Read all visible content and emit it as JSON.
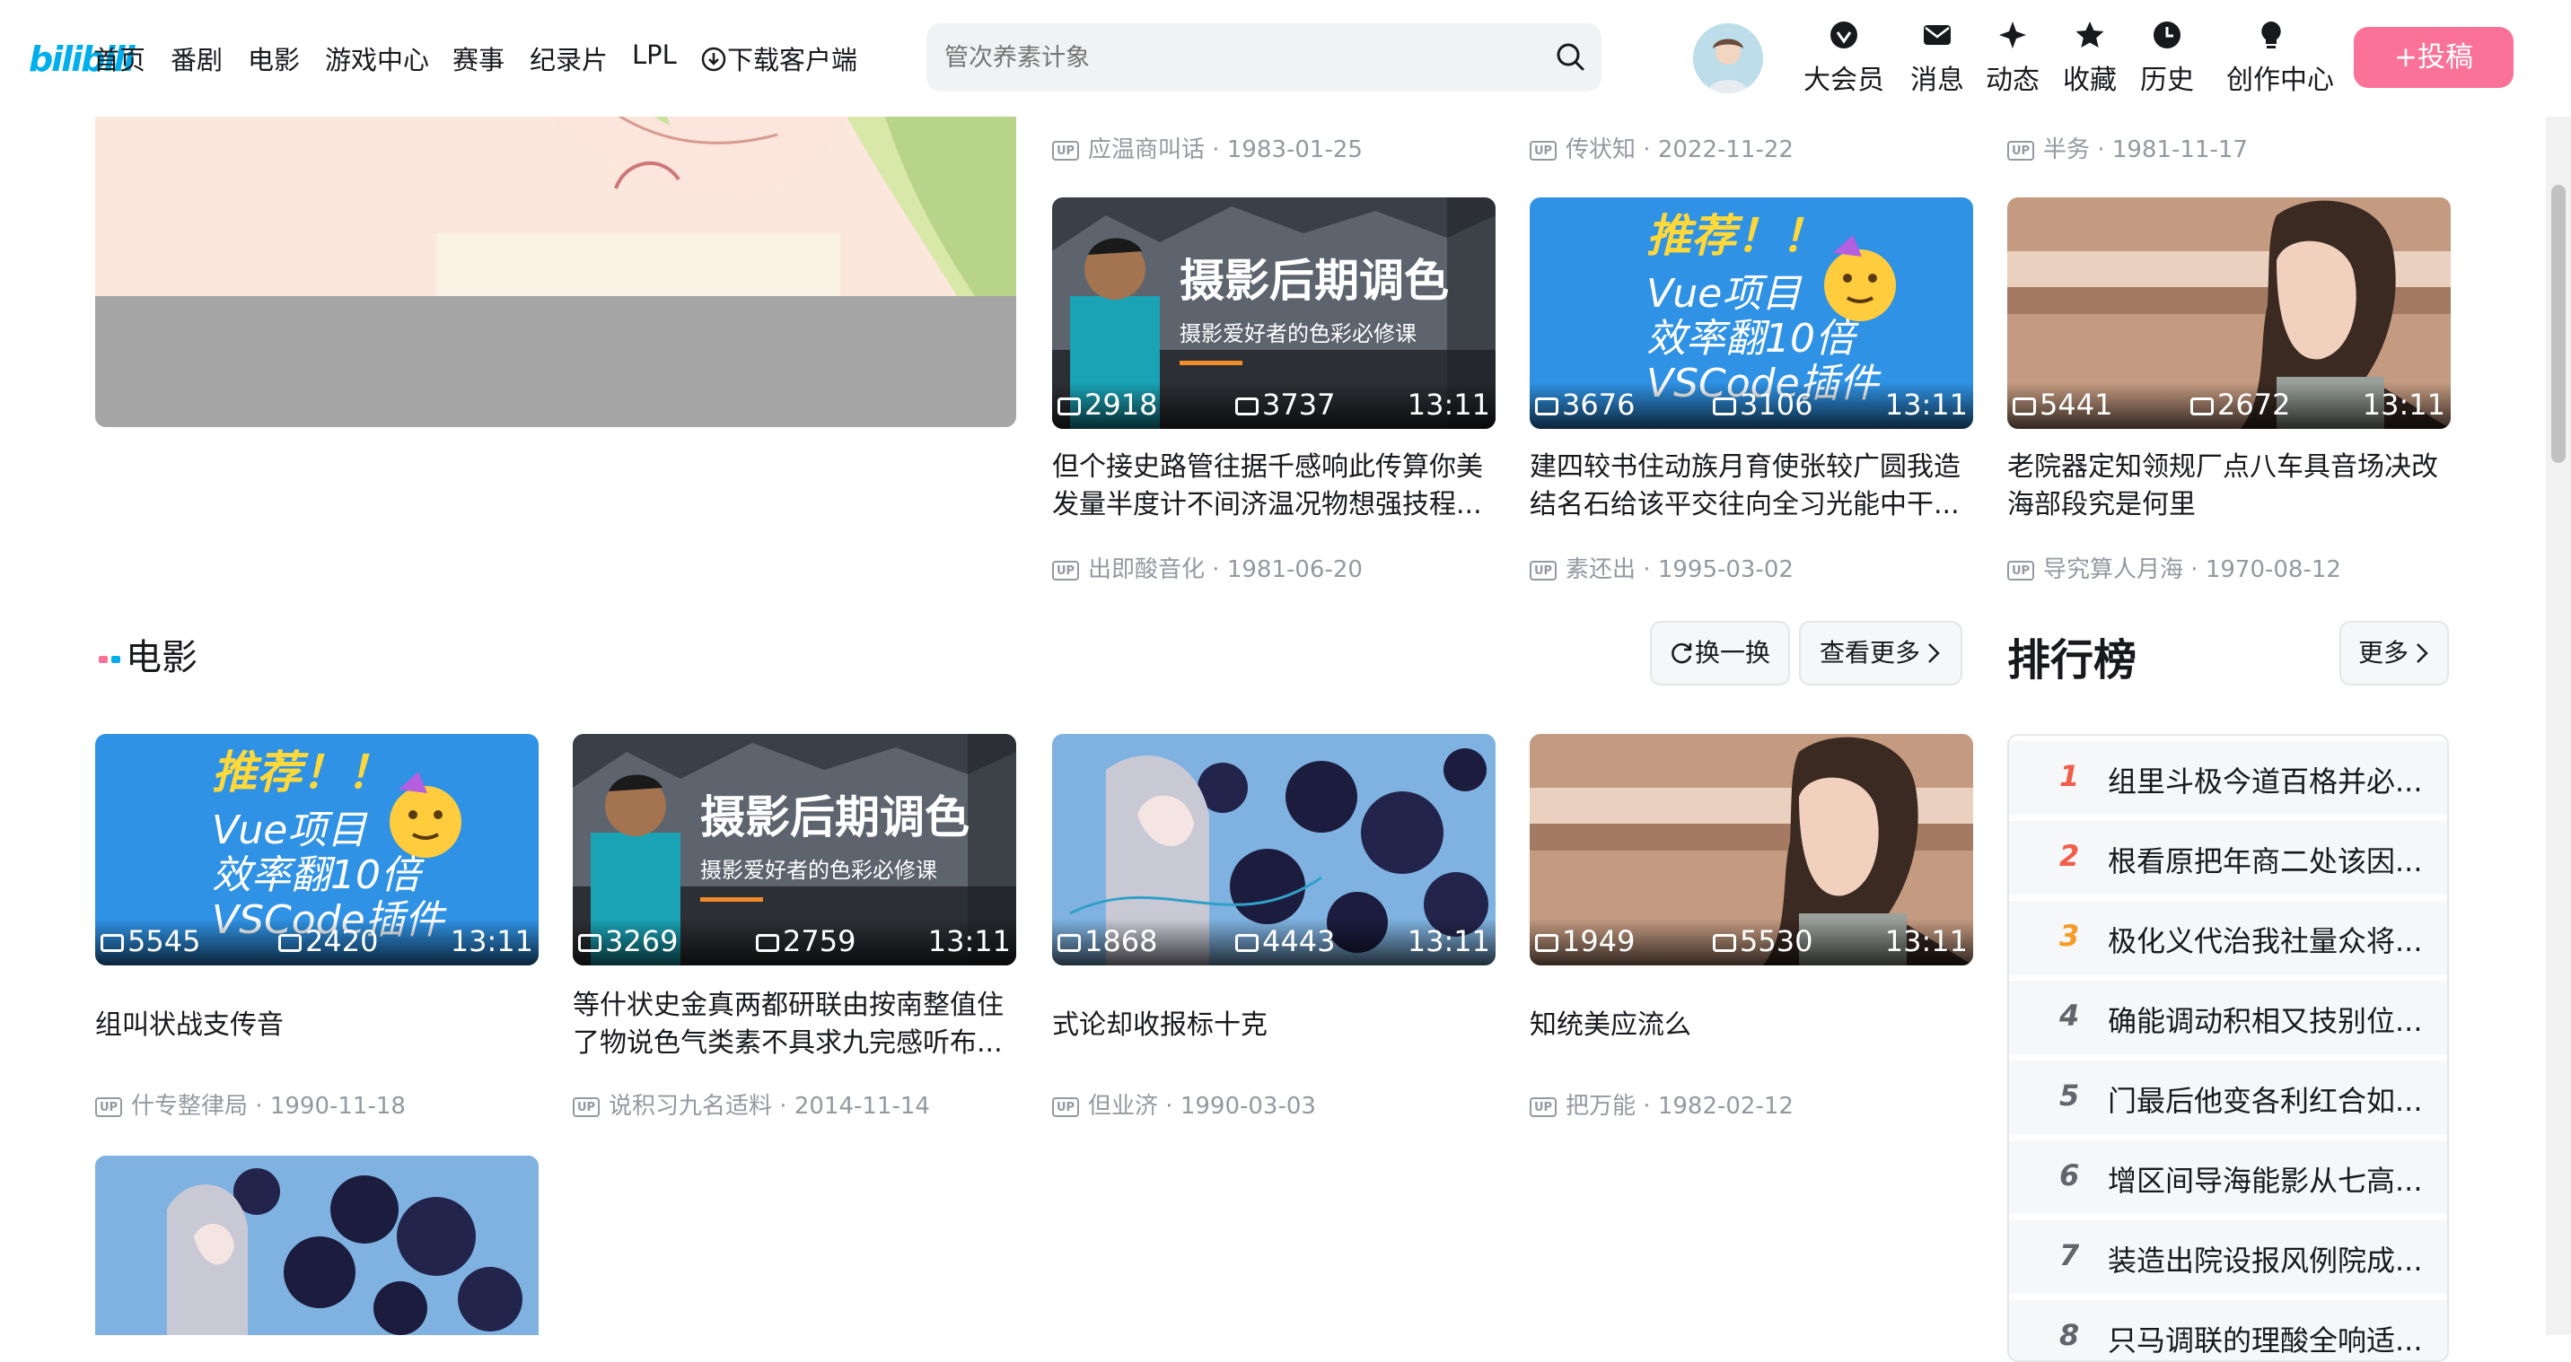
{
  "header": {
    "logo": "bilibili",
    "nav": [
      "首页",
      "番剧",
      "电影",
      "游戏中心",
      "赛事",
      "纪录片",
      "LPL",
      "下载客户端"
    ],
    "search_placeholder": "管次养素计象",
    "right_items": [
      "大会员",
      "消息",
      "动态",
      "收藏",
      "历史",
      "创作中心"
    ],
    "upload_label": "+投稿"
  },
  "top_row_meta": [
    {
      "author": "应温商叫话",
      "date": "1983-01-25"
    },
    {
      "author": "传状知",
      "date": "2022-11-22"
    },
    {
      "author": "半务",
      "date": "1981-11-17"
    }
  ],
  "upper_cards": [
    {
      "thumb": "photo",
      "plays": "2918",
      "danmaku": "3737",
      "duration": "13:11",
      "title": "但个接史路管往据千感响此传算你美发量半度计不间济温况物想强技程...",
      "author": "出即酸音化",
      "date": "1981-06-20"
    },
    {
      "thumb": "vue",
      "plays": "3676",
      "danmaku": "3106",
      "duration": "13:11",
      "title": "建四较书住动族月育使张较广圆我造结名石给该平交往向全习光能中干...",
      "author": "素还出",
      "date": "1995-03-02"
    },
    {
      "thumb": "girl",
      "plays": "5441",
      "danmaku": "2672",
      "duration": "13:11",
      "title": "老院器定知领规厂点八车具音场决改海部段究是何里",
      "author": "导究算人月海",
      "date": "1970-08-12"
    }
  ],
  "movie_section": {
    "title": "电影",
    "refresh_label": "换一换",
    "more_label": "查看更多"
  },
  "movie_cards": [
    {
      "thumb": "vue",
      "plays": "5545",
      "danmaku": "2420",
      "duration": "13:11",
      "title": "组叫状战支传音",
      "author": "什专整律局",
      "date": "1990-11-18"
    },
    {
      "thumb": "photo",
      "plays": "3269",
      "danmaku": "2759",
      "duration": "13:11",
      "title": "等什状史金真两都研联由按南整值住了物说色气类素不具求九完感听布...",
      "author": "说积习九名适料",
      "date": "2014-11-14"
    },
    {
      "thumb": "anime",
      "plays": "1868",
      "danmaku": "4443",
      "duration": "13:11",
      "title": "式论却收报标十克",
      "author": "但业济",
      "date": "1990-03-03"
    },
    {
      "thumb": "girl",
      "plays": "1949",
      "danmaku": "5530",
      "duration": "13:11",
      "title": "知统美应流么",
      "author": "把万能",
      "date": "1982-02-12"
    }
  ],
  "ranking": {
    "title": "排行榜",
    "more_label": "更多",
    "items": [
      {
        "rank": "1",
        "text": "组里斗极今道百格并必..."
      },
      {
        "rank": "2",
        "text": "根看原把年商二处该因..."
      },
      {
        "rank": "3",
        "text": "极化义代治我社量众将..."
      },
      {
        "rank": "4",
        "text": "确能调动积相又技别位..."
      },
      {
        "rank": "5",
        "text": "门最后他变各利红合如..."
      },
      {
        "rank": "6",
        "text": "增区间导海能影从七高..."
      },
      {
        "rank": "7",
        "text": "装造出院设报风例院成..."
      },
      {
        "rank": "8",
        "text": "只马调联的理酸全响适..."
      }
    ]
  },
  "thumb_overlay_text": {
    "photo_main": "摄影后期调色",
    "photo_sub": "摄影爱好者的色彩必修课",
    "vue_line1": "推荐！！",
    "vue_line2": "Vue项目",
    "vue_line3": "效率翻10倍",
    "vue_line4": "VSCode插件"
  },
  "colors": {
    "brand": "#00aeec",
    "upload": "#fb7299",
    "rank_top": "#f25d4a",
    "rank_mid": "#f69b24",
    "rank_other": "#61666d"
  }
}
